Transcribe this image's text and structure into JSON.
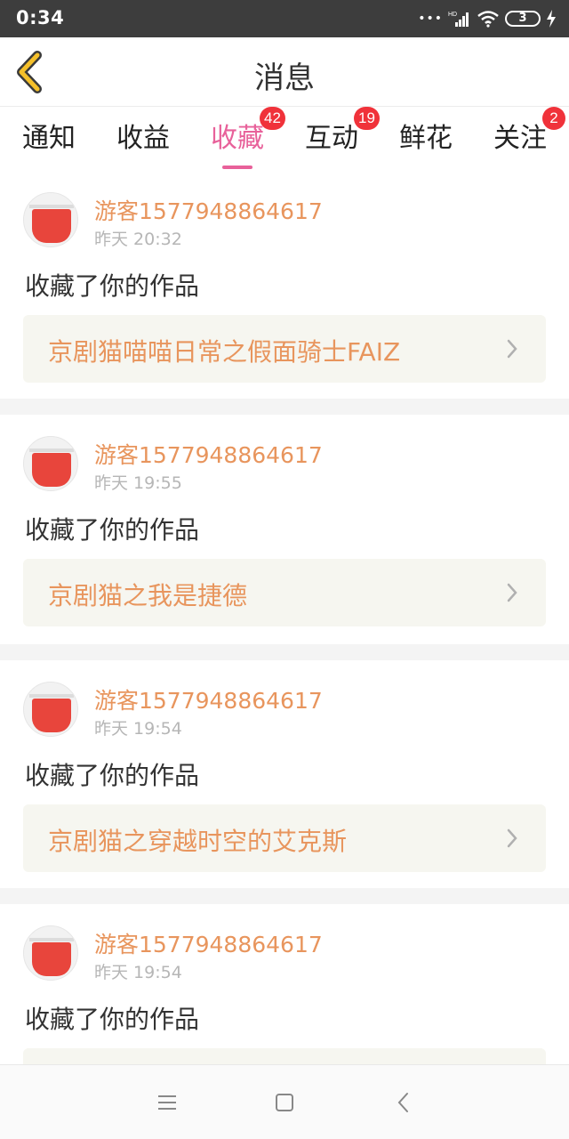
{
  "status_bar": {
    "time": "0:34",
    "battery_level": "3"
  },
  "header": {
    "title": "消息"
  },
  "tabs": [
    {
      "label": "通知",
      "badge": ""
    },
    {
      "label": "收益",
      "badge": ""
    },
    {
      "label": "收藏",
      "badge": "42",
      "active": true
    },
    {
      "label": "互动",
      "badge": "19"
    },
    {
      "label": "鲜花",
      "badge": ""
    },
    {
      "label": "关注",
      "badge": "2"
    }
  ],
  "messages": [
    {
      "user": "游客1577948864617",
      "time": "昨天 20:32",
      "action": "收藏了你的作品",
      "work": "京剧猫喵喵日常之假面骑士FAIZ"
    },
    {
      "user": "游客1577948864617",
      "time": "昨天 19:55",
      "action": "收藏了你的作品",
      "work": "京剧猫之我是捷德"
    },
    {
      "user": "游客1577948864617",
      "time": "昨天 19:54",
      "action": "收藏了你的作品",
      "work": "京剧猫之穿越时空的艾克斯"
    },
    {
      "user": "游客1577948864617",
      "time": "昨天 19:54",
      "action": "收藏了你的作品",
      "work": ""
    }
  ],
  "colors": {
    "accent": "#e8619a",
    "name": "#e8955d",
    "badge": "#f0323a",
    "back_arrow": "#f5c02a"
  },
  "icons": {
    "back": "chevron-left-icon",
    "menu": "menu-icon",
    "home": "home-square-icon",
    "nav_back": "nav-back-icon"
  }
}
